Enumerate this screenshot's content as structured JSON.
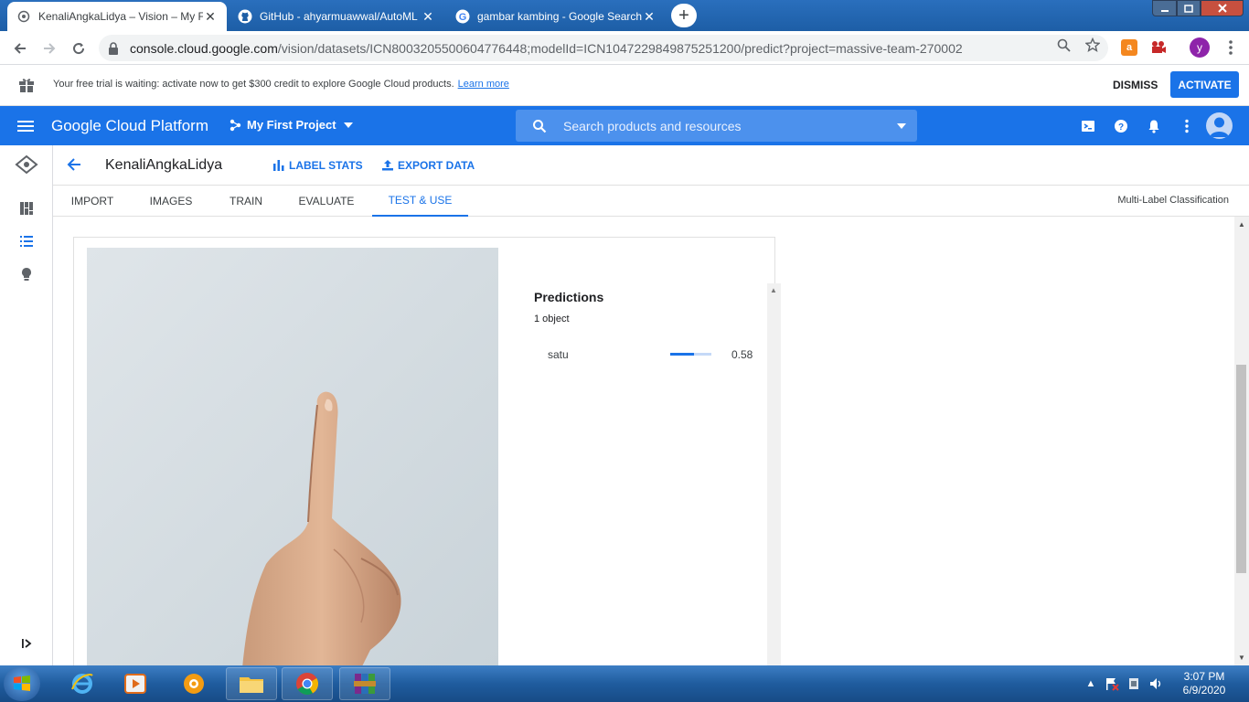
{
  "browser": {
    "tabs": [
      {
        "title": "KenaliAngkaLidya – Vision – My F",
        "close": "✕",
        "active": true
      },
      {
        "title": "GitHub - ahyarmuawwal/AutoML",
        "close": "✕",
        "active": false
      },
      {
        "title": "gambar kambing - Google Search",
        "close": "✕",
        "active": false
      }
    ],
    "new_tab": "+",
    "url_host": "console.cloud.google.com",
    "url_path": "/vision/datasets/ICN8003205500604776448;modelId=ICN1047229849875251200/predict?project=massive-team-270002",
    "profile_initial": "y"
  },
  "banner": {
    "text": "Your free trial is waiting: activate now to get $300 credit to explore Google Cloud products.",
    "learn_more": "Learn more",
    "dismiss": "DISMISS",
    "activate": "ACTIVATE"
  },
  "gcp": {
    "title": "Google Cloud Platform",
    "project": "My First Project",
    "search_placeholder": "Search products and resources"
  },
  "page": {
    "dataset_name": "KenaliAngkaLidya",
    "label_stats": "LABEL STATS",
    "export_data": "EXPORT DATA",
    "tabs": [
      "IMPORT",
      "IMAGES",
      "TRAIN",
      "EVALUATE",
      "TEST & USE"
    ],
    "active_tab": "TEST & USE",
    "mode": "Multi-Label Classification"
  },
  "predictions": {
    "title": "Predictions",
    "count": "1 object",
    "items": [
      {
        "label": "satu",
        "score": 0.58,
        "score_text": "0.58"
      }
    ]
  },
  "taskbar": {
    "time": "3:07 PM",
    "date": "6/9/2020"
  },
  "colors": {
    "gcp_blue": "#1a73e8",
    "taskbar": "#1f5c9e"
  }
}
